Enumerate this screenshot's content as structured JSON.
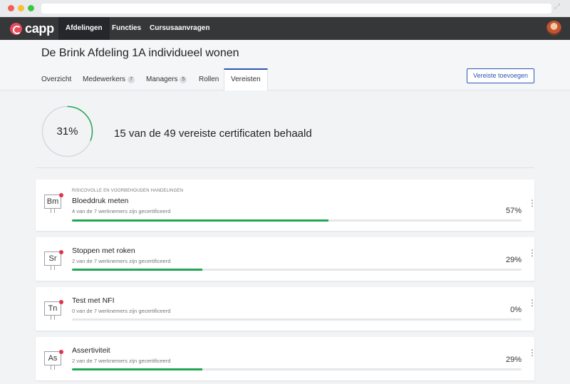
{
  "nav": {
    "logo_text": "capp",
    "items": [
      {
        "label": "Afdelingen",
        "active": true
      },
      {
        "label": "Functies",
        "active": false
      },
      {
        "label": "Cursusaanvragen",
        "active": false
      }
    ]
  },
  "header": {
    "title": "De Brink Afdeling 1A individueel wonen",
    "tabs": [
      {
        "label": "Overzicht",
        "count": null
      },
      {
        "label": "Medewerkers",
        "count": "7"
      },
      {
        "label": "Managers",
        "count": "5"
      },
      {
        "label": "Rollen",
        "count": null
      },
      {
        "label": "Vereisten",
        "count": null,
        "active": true
      }
    ],
    "add_button": "Vereiste toevoegen"
  },
  "summary": {
    "percent_label": "31%",
    "percent_value": 0.31,
    "text": "15 van de 49 vereiste certificaten behaald"
  },
  "requirements": [
    {
      "category": "RISICOVOLLE EN VOORBEHOUDEN HANDELINGEN",
      "badge": "Bm",
      "title": "Bloeddruk meten",
      "subtitle": "4 van de 7 werknemers zijn gecertificeerd",
      "percent_label": "57%",
      "progress": 0.57
    },
    {
      "category": "",
      "badge": "Sr",
      "title": "Stoppen met roken",
      "subtitle": "2 van de 7 werknemers zijn gecertificeerd",
      "percent_label": "29%",
      "progress": 0.29
    },
    {
      "category": "",
      "badge": "Tn",
      "title": "Test met NFI",
      "subtitle": "0 van de 7 werknemers zijn gecertificeerd",
      "percent_label": "0%",
      "progress": 0
    },
    {
      "category": "",
      "badge": "As",
      "title": "Assertiviteit",
      "subtitle": "2 van de 7 werknemers zijn gecertificeerd",
      "percent_label": "29%",
      "progress": 0.29
    }
  ],
  "colors": {
    "accent": "#2f54b5",
    "progress": "#21a654",
    "notification": "#e2324b"
  }
}
